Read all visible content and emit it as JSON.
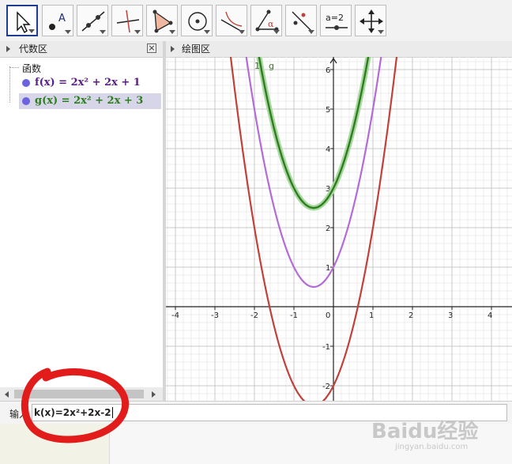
{
  "toolbar": {
    "tools": [
      {
        "name": "move-tool-icon",
        "selected": true
      },
      {
        "name": "point-tool-icon",
        "label": "A"
      },
      {
        "name": "line-tool-icon"
      },
      {
        "name": "perpendicular-line-tool-icon"
      },
      {
        "name": "polygon-tool-icon"
      },
      {
        "name": "circle-tool-icon"
      },
      {
        "name": "tangent-circle-tool-icon"
      },
      {
        "name": "angle-tool-icon",
        "label": "α"
      },
      {
        "name": "reflect-tool-icon"
      },
      {
        "name": "slider-tool-icon",
        "label": "a=2"
      },
      {
        "name": "move-view-tool-icon"
      }
    ]
  },
  "algebra": {
    "title": "代数区",
    "category": "函数",
    "items": [
      {
        "name": "f",
        "color": "#5a1f86",
        "label": "f(x) = 2x² + 2x + 1"
      },
      {
        "name": "g",
        "color": "#2e7d1e",
        "label": "g(x) = 2x² + 2x + 3"
      }
    ]
  },
  "graphics": {
    "title": "绘图区",
    "label_1": "1",
    "label_g": "g",
    "x_ticks": [
      "-4",
      "-3",
      "-2",
      "-1",
      "0",
      "1",
      "2",
      "3",
      "4"
    ],
    "y_ticks": [
      "6",
      "5",
      "4",
      "3",
      "2",
      "1",
      "-1",
      "-2"
    ]
  },
  "curves": {
    "f": {
      "a": 2,
      "b": 2,
      "c": 1,
      "color": "#b36bd6"
    },
    "g": {
      "a": 2,
      "b": 2,
      "c": 3,
      "color": "#2e7d1e",
      "halo": "#a8d8a0"
    },
    "h": {
      "a": 2,
      "b": 2,
      "c": -2,
      "color": "#c0413a"
    }
  },
  "input": {
    "label": "输入",
    "value": "k(x)=2x²+2x-2"
  },
  "watermark": {
    "brand": "Baidu经验",
    "sub": "jingyan.baidu.com"
  }
}
